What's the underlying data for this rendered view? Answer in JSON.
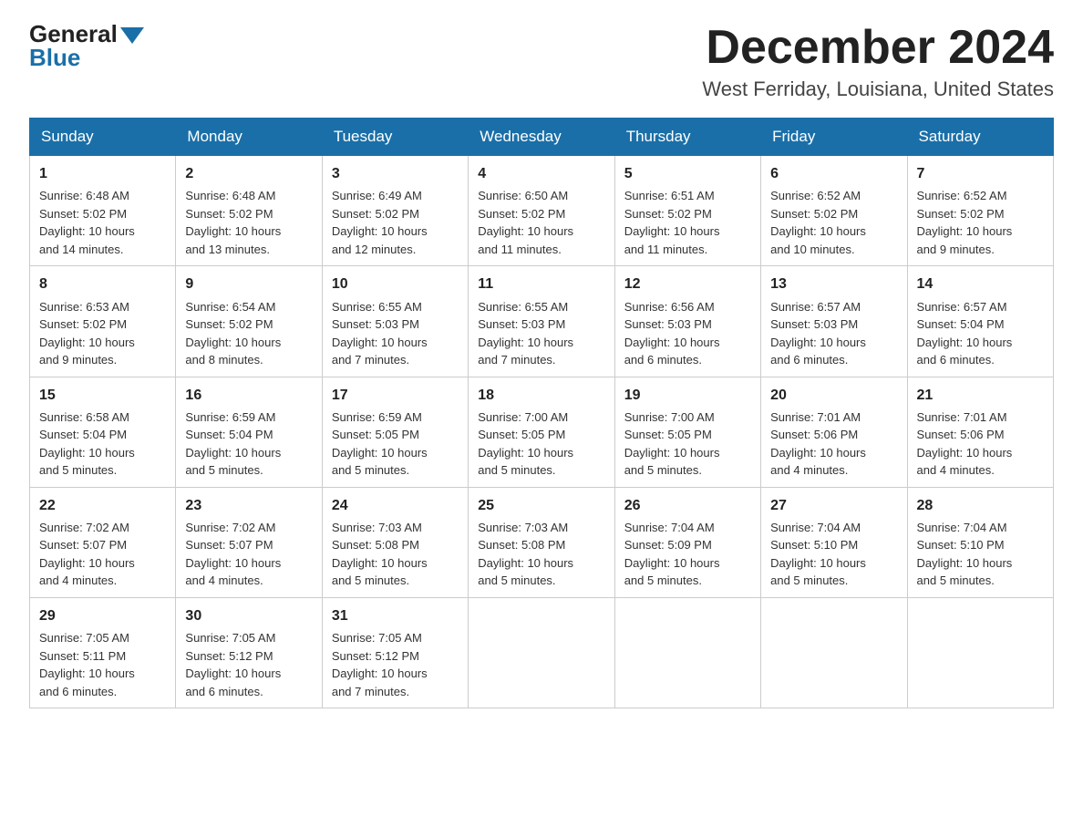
{
  "header": {
    "logo_general": "General",
    "logo_blue": "Blue",
    "month_year": "December 2024",
    "location": "West Ferriday, Louisiana, United States"
  },
  "weekdays": [
    "Sunday",
    "Monday",
    "Tuesday",
    "Wednesday",
    "Thursday",
    "Friday",
    "Saturday"
  ],
  "weeks": [
    [
      {
        "day": "1",
        "sunrise": "6:48 AM",
        "sunset": "5:02 PM",
        "daylight": "10 hours and 14 minutes."
      },
      {
        "day": "2",
        "sunrise": "6:48 AM",
        "sunset": "5:02 PM",
        "daylight": "10 hours and 13 minutes."
      },
      {
        "day": "3",
        "sunrise": "6:49 AM",
        "sunset": "5:02 PM",
        "daylight": "10 hours and 12 minutes."
      },
      {
        "day": "4",
        "sunrise": "6:50 AM",
        "sunset": "5:02 PM",
        "daylight": "10 hours and 11 minutes."
      },
      {
        "day": "5",
        "sunrise": "6:51 AM",
        "sunset": "5:02 PM",
        "daylight": "10 hours and 11 minutes."
      },
      {
        "day": "6",
        "sunrise": "6:52 AM",
        "sunset": "5:02 PM",
        "daylight": "10 hours and 10 minutes."
      },
      {
        "day": "7",
        "sunrise": "6:52 AM",
        "sunset": "5:02 PM",
        "daylight": "10 hours and 9 minutes."
      }
    ],
    [
      {
        "day": "8",
        "sunrise": "6:53 AM",
        "sunset": "5:02 PM",
        "daylight": "10 hours and 9 minutes."
      },
      {
        "day": "9",
        "sunrise": "6:54 AM",
        "sunset": "5:02 PM",
        "daylight": "10 hours and 8 minutes."
      },
      {
        "day": "10",
        "sunrise": "6:55 AM",
        "sunset": "5:03 PM",
        "daylight": "10 hours and 7 minutes."
      },
      {
        "day": "11",
        "sunrise": "6:55 AM",
        "sunset": "5:03 PM",
        "daylight": "10 hours and 7 minutes."
      },
      {
        "day": "12",
        "sunrise": "6:56 AM",
        "sunset": "5:03 PM",
        "daylight": "10 hours and 6 minutes."
      },
      {
        "day": "13",
        "sunrise": "6:57 AM",
        "sunset": "5:03 PM",
        "daylight": "10 hours and 6 minutes."
      },
      {
        "day": "14",
        "sunrise": "6:57 AM",
        "sunset": "5:04 PM",
        "daylight": "10 hours and 6 minutes."
      }
    ],
    [
      {
        "day": "15",
        "sunrise": "6:58 AM",
        "sunset": "5:04 PM",
        "daylight": "10 hours and 5 minutes."
      },
      {
        "day": "16",
        "sunrise": "6:59 AM",
        "sunset": "5:04 PM",
        "daylight": "10 hours and 5 minutes."
      },
      {
        "day": "17",
        "sunrise": "6:59 AM",
        "sunset": "5:05 PM",
        "daylight": "10 hours and 5 minutes."
      },
      {
        "day": "18",
        "sunrise": "7:00 AM",
        "sunset": "5:05 PM",
        "daylight": "10 hours and 5 minutes."
      },
      {
        "day": "19",
        "sunrise": "7:00 AM",
        "sunset": "5:05 PM",
        "daylight": "10 hours and 5 minutes."
      },
      {
        "day": "20",
        "sunrise": "7:01 AM",
        "sunset": "5:06 PM",
        "daylight": "10 hours and 4 minutes."
      },
      {
        "day": "21",
        "sunrise": "7:01 AM",
        "sunset": "5:06 PM",
        "daylight": "10 hours and 4 minutes."
      }
    ],
    [
      {
        "day": "22",
        "sunrise": "7:02 AM",
        "sunset": "5:07 PM",
        "daylight": "10 hours and 4 minutes."
      },
      {
        "day": "23",
        "sunrise": "7:02 AM",
        "sunset": "5:07 PM",
        "daylight": "10 hours and 4 minutes."
      },
      {
        "day": "24",
        "sunrise": "7:03 AM",
        "sunset": "5:08 PM",
        "daylight": "10 hours and 5 minutes."
      },
      {
        "day": "25",
        "sunrise": "7:03 AM",
        "sunset": "5:08 PM",
        "daylight": "10 hours and 5 minutes."
      },
      {
        "day": "26",
        "sunrise": "7:04 AM",
        "sunset": "5:09 PM",
        "daylight": "10 hours and 5 minutes."
      },
      {
        "day": "27",
        "sunrise": "7:04 AM",
        "sunset": "5:10 PM",
        "daylight": "10 hours and 5 minutes."
      },
      {
        "day": "28",
        "sunrise": "7:04 AM",
        "sunset": "5:10 PM",
        "daylight": "10 hours and 5 minutes."
      }
    ],
    [
      {
        "day": "29",
        "sunrise": "7:05 AM",
        "sunset": "5:11 PM",
        "daylight": "10 hours and 6 minutes."
      },
      {
        "day": "30",
        "sunrise": "7:05 AM",
        "sunset": "5:12 PM",
        "daylight": "10 hours and 6 minutes."
      },
      {
        "day": "31",
        "sunrise": "7:05 AM",
        "sunset": "5:12 PM",
        "daylight": "10 hours and 7 minutes."
      },
      null,
      null,
      null,
      null
    ]
  ],
  "labels": {
    "sunrise": "Sunrise:",
    "sunset": "Sunset:",
    "daylight": "Daylight:"
  }
}
